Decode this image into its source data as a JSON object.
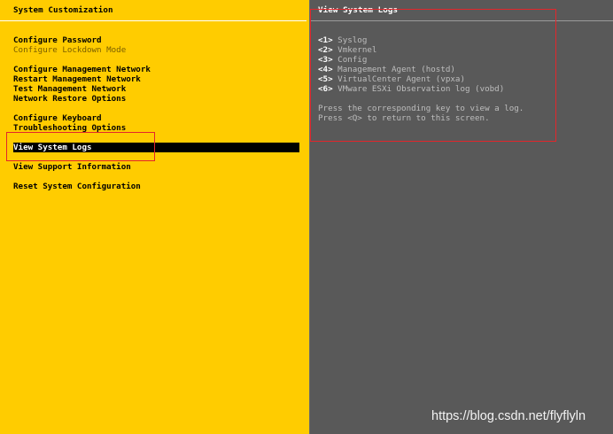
{
  "left_panel": {
    "title": "System Customization",
    "menu": [
      {
        "label": "Configure Password",
        "dim": false
      },
      {
        "label": "Configure Lockdown Mode",
        "dim": true
      },
      {
        "label": "",
        "spacer": true
      },
      {
        "label": "Configure Management Network",
        "dim": false
      },
      {
        "label": "Restart Management Network",
        "dim": false
      },
      {
        "label": "Test Management Network",
        "dim": false
      },
      {
        "label": "Network Restore Options",
        "dim": false
      },
      {
        "label": "",
        "spacer": true
      },
      {
        "label": "Configure Keyboard",
        "dim": false
      },
      {
        "label": "Troubleshooting Options",
        "dim": false
      },
      {
        "label": "",
        "spacer": true
      },
      {
        "label": "View System Logs",
        "dim": false,
        "selected": true
      },
      {
        "label": "",
        "spacer": true
      },
      {
        "label": "View Support Information",
        "dim": false
      },
      {
        "label": "",
        "spacer": true
      },
      {
        "label": "Reset System Configuration",
        "dim": false
      }
    ]
  },
  "right_panel": {
    "title": "View System Logs",
    "logs": [
      {
        "key": "<1>",
        "name": "Syslog"
      },
      {
        "key": "<2>",
        "name": "Vmkernel"
      },
      {
        "key": "<3>",
        "name": "Config"
      },
      {
        "key": "<4>",
        "name": "Management Agent (hostd)"
      },
      {
        "key": "<5>",
        "name": "VirtualCenter Agent (vpxa)"
      },
      {
        "key": "<6>",
        "name": "VMware ESXi Observation log (vobd)"
      }
    ],
    "hint_lines": [
      "Press the corresponding key to view a log.",
      "Press <Q> to return to this screen."
    ]
  },
  "watermark": "https://blog.csdn.net/flyflyln",
  "colors": {
    "left_bg": "#ffcc00",
    "right_bg": "#595959",
    "annotation": "#e3262b",
    "selected_bg": "#000000"
  }
}
